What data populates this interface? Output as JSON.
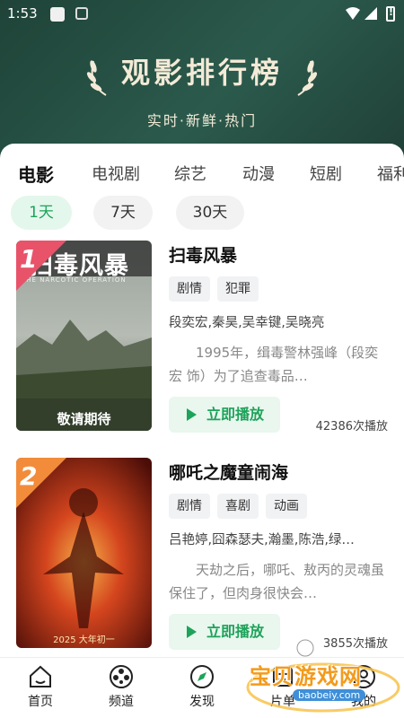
{
  "status_bar": {
    "time": "1:53"
  },
  "header": {
    "title": "观影排行榜",
    "subtitle": "实时·新鲜·热门"
  },
  "category_tabs": [
    {
      "label": "电影",
      "active": true
    },
    {
      "label": "电视剧",
      "active": false
    },
    {
      "label": "综艺",
      "active": false
    },
    {
      "label": "动漫",
      "active": false
    },
    {
      "label": "短剧",
      "active": false
    },
    {
      "label": "福利",
      "active": false
    }
  ],
  "time_ranges": [
    {
      "label": "1天",
      "active": true
    },
    {
      "label": "7天",
      "active": false
    },
    {
      "label": "30天",
      "active": false
    }
  ],
  "movies": [
    {
      "rank": "1",
      "title": "扫毒风暴",
      "genres": [
        "剧情",
        "犯罪"
      ],
      "cast": "段奕宏,秦昊,吴幸键,吴晓亮",
      "description": "1995年，缉毒警林强峰（段奕宏 饰）为了追查毒品…",
      "play_label": "立即播放",
      "play_count": "42386次播放",
      "poster_title": "扫毒风暴",
      "poster_caption": "敬请期待",
      "poster_subtitle": "THE NARCOTIC OPERATION"
    },
    {
      "rank": "2",
      "title": "哪吒之魔童闹海",
      "genres": [
        "剧情",
        "喜剧",
        "动画"
      ],
      "cast": "吕艳婷,囧森瑟夫,瀚墨,陈浩,绿…",
      "description": "天劫之后，哪吒、敖丙的灵魂虽保住了，但肉身很快会…",
      "play_label": "立即播放",
      "play_count": "3855次播放",
      "poster_caption": "2025 大年初一"
    }
  ],
  "bottom_nav": [
    {
      "label": "首页",
      "icon": "home-icon"
    },
    {
      "label": "频道",
      "icon": "film-reel-icon"
    },
    {
      "label": "发现",
      "icon": "compass-icon"
    },
    {
      "label": "片单",
      "icon": "list-icon"
    },
    {
      "label": "我的",
      "icon": "user-icon"
    }
  ],
  "watermark": {
    "text": "宝贝游戏网",
    "url": "baobeiy.com"
  },
  "colors": {
    "accent": "#1ea35a",
    "header_bg": "#2b5a4c",
    "rank1": "#e8536a",
    "rank2": "#f28c3a",
    "title_gold": "#f3ead7"
  }
}
